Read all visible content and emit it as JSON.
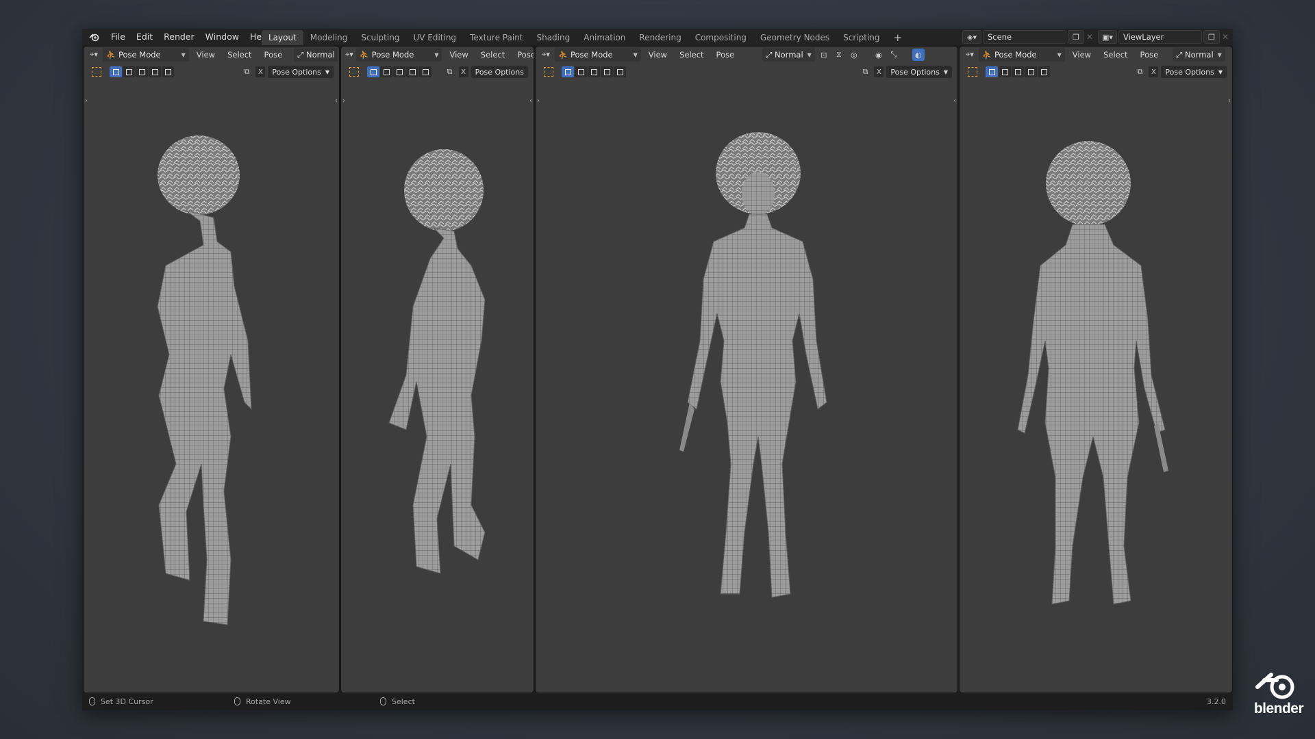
{
  "menu": [
    "File",
    "Edit",
    "Render",
    "Window",
    "Help"
  ],
  "workspaces": [
    {
      "label": "Layout",
      "active": true
    },
    {
      "label": "Modeling"
    },
    {
      "label": "Sculpting"
    },
    {
      "label": "UV Editing"
    },
    {
      "label": "Texture Paint"
    },
    {
      "label": "Shading"
    },
    {
      "label": "Animation"
    },
    {
      "label": "Rendering"
    },
    {
      "label": "Compositing"
    },
    {
      "label": "Geometry Nodes"
    },
    {
      "label": "Scripting"
    }
  ],
  "add_workspace": "+",
  "scene": {
    "label": "Scene",
    "view_layer": "ViewLayer"
  },
  "viewports": [
    {
      "mode": "Pose Mode",
      "menus": [
        "View",
        "Select",
        "Pose"
      ],
      "orientation": "Normal",
      "pose_options": "Pose Options",
      "x_label": "X",
      "view": "side-left"
    },
    {
      "mode": "Pose Mode",
      "menus": [
        "View",
        "Select",
        "Pose"
      ],
      "orientation": "",
      "pose_options": "Pose Options",
      "x_label": "X",
      "view": "side-right"
    },
    {
      "mode": "Pose Mode",
      "menus": [
        "View",
        "Select",
        "Pose"
      ],
      "orientation": "Normal",
      "pose_options": "Pose Options",
      "x_label": "X",
      "view": "front"
    },
    {
      "mode": "Pose Mode",
      "menus": [
        "View",
        "Select",
        "Pose"
      ],
      "orientation": "Normal",
      "pose_options": "Pose Options",
      "x_label": "X",
      "view": "back"
    }
  ],
  "status": {
    "left": "Set 3D Cursor",
    "middle": "Rotate View",
    "right": "Select",
    "version": "3.2.0"
  },
  "brand": "blender",
  "colors": {
    "accent": "#3f6fbf",
    "selection": "#e8a33a",
    "viewport_bg": "#3d3d3d",
    "topbar": "#232323"
  }
}
